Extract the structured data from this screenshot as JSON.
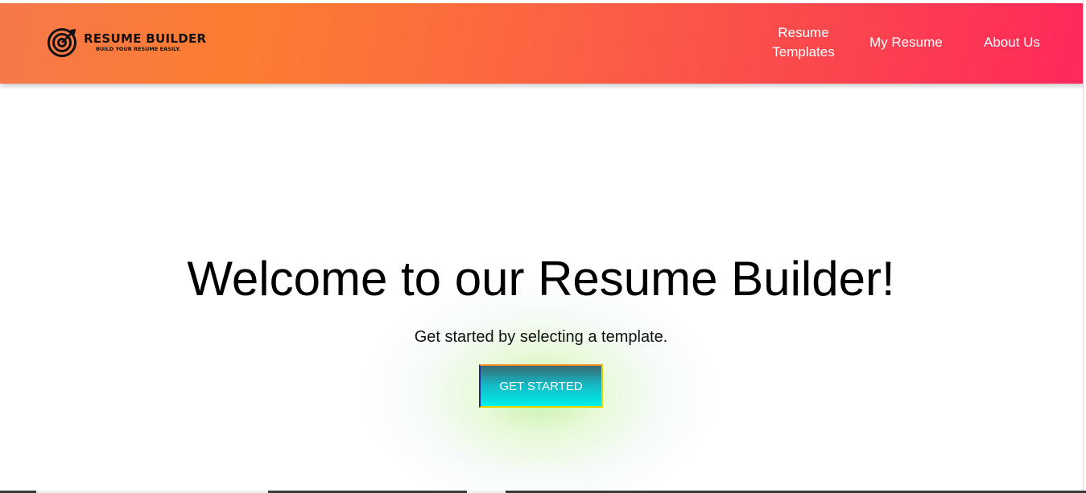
{
  "brand": {
    "title": "RESUME BUILDER",
    "tagline": "BUILD YOUR RESUME EASILY.",
    "icon": "target-arrow-icon"
  },
  "nav": {
    "items": [
      {
        "label": "Resume Templates"
      },
      {
        "label": "My Resume"
      },
      {
        "label": "About Us"
      }
    ]
  },
  "hero": {
    "title": "Welcome to our Resume Builder!",
    "subtitle": "Get started by selecting a template.",
    "cta_label": "GET STARTED"
  },
  "colors": {
    "navbar_gradient_start": "#f5784c",
    "navbar_gradient_end": "#ff285c",
    "cta_gradient_top": "#3a6a74",
    "cta_gradient_bottom": "#00f0ea",
    "text_primary": "#000000",
    "nav_text": "#ffffff"
  }
}
